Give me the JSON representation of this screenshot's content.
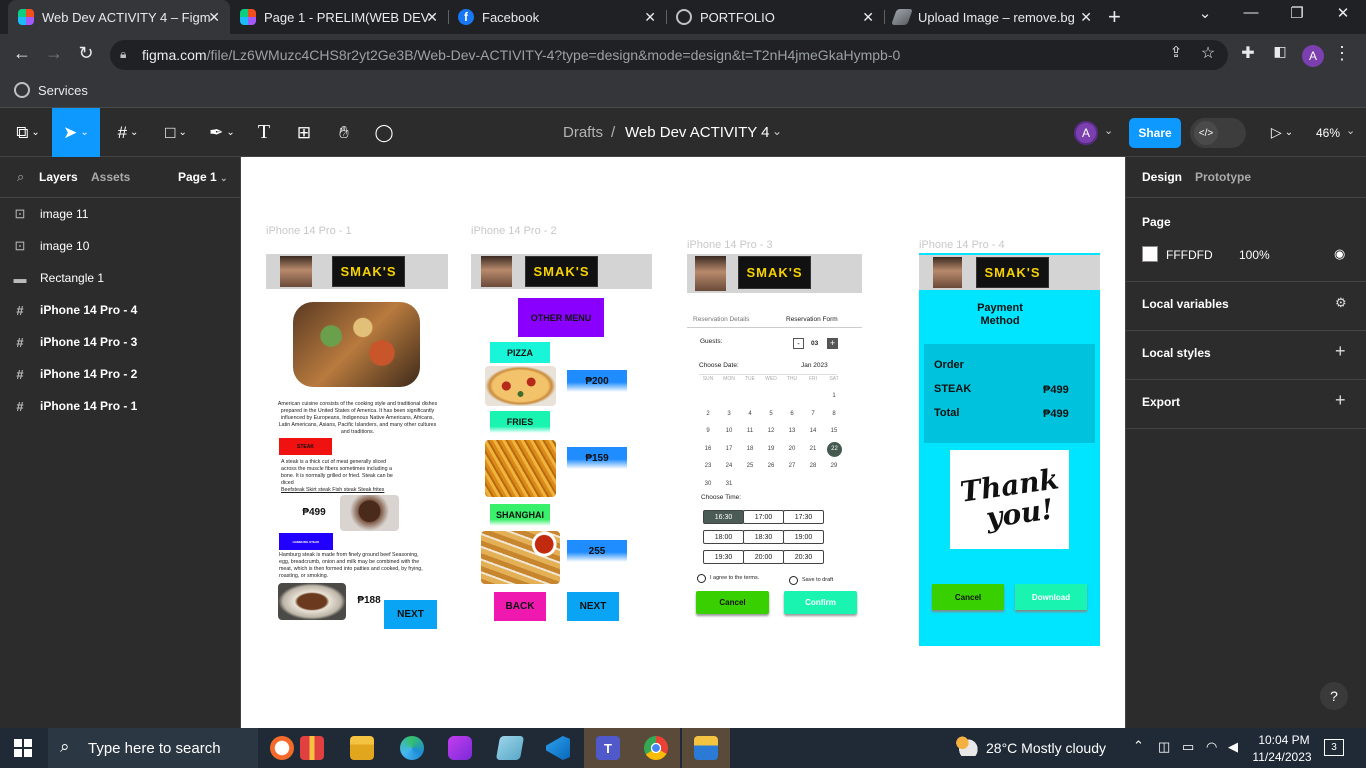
{
  "browser": {
    "tabs": [
      {
        "label": "Web Dev ACTIVITY 4 – Figm",
        "active": true
      },
      {
        "label": "Page 1 - PRELIM(WEB DEV"
      },
      {
        "label": "Facebook"
      },
      {
        "label": "PORTFOLIO"
      },
      {
        "label": "Upload Image – remove.bg"
      }
    ],
    "url_domain": "figma.com",
    "url_path": "/file/Lz6WMuzc4CHS8r2yt2Ge3B/Web-Dev-ACTIVITY-4?type=design&mode=design&t=T2nH4jmeGkaHympb-0",
    "bookmark": "Services",
    "profile_initial": "A"
  },
  "toolbar": {
    "breadcrumb_root": "Drafts",
    "breadcrumb_sep": "/",
    "file_name": "Web Dev ACTIVITY 4",
    "avatar": "A",
    "share_label": "Share",
    "zoom": "46%"
  },
  "leftpanel": {
    "tab_layers": "Layers",
    "tab_assets": "Assets",
    "page": "Page 1",
    "layers": [
      {
        "icon": "image-icon",
        "label": "image 11"
      },
      {
        "icon": "image-icon",
        "label": "image 10"
      },
      {
        "icon": "rectangle-icon",
        "label": "Rectangle 1"
      },
      {
        "icon": "frame-icon",
        "label": "iPhone 14 Pro - 4"
      },
      {
        "icon": "frame-icon",
        "label": "iPhone 14 Pro - 3"
      },
      {
        "icon": "frame-icon",
        "label": "iPhone 14 Pro - 2"
      },
      {
        "icon": "frame-icon",
        "label": "iPhone 14 Pro - 1"
      }
    ]
  },
  "rightpanel": {
    "tab_design": "Design",
    "tab_prototype": "Prototype",
    "page_heading": "Page",
    "page_color": "FFFDFD",
    "page_opacity": "100%",
    "local_variables": "Local variables",
    "local_styles": "Local styles",
    "export": "Export",
    "help": "?"
  },
  "canvas": {
    "frame1": {
      "label": "iPhone 14 Pro - 1",
      "logo": "SMAK'S",
      "desc": "American cuisine consists of the cooking style and traditional dishes prepared in the United States of America. It has been significantly influenced by Europeans, Indigenous Native Americans, Africans, Latin Americans, Asians, Pacific Islanders, and many other cultures and traditions.",
      "steak_tag": "STEAK",
      "steak_desc": "A steak is a thick cut of meat generally sliced across the muscle fibers sometimes including a bone. It is normally grilled or fried. Steak can be diced",
      "steak_types": "Beefsteak  Skirt steak   Fish steak   Steak frites",
      "steak_price": "₱499",
      "hamburg_tag": "HAMBURG STEAK",
      "hamburg_desc": "Hamburg steak is made from finely ground beef Seasoning, egg, breadcrumb, onion and milk may be combined with the meat, which is then formed into patties and cooked, by frying, roasting, or smoking.",
      "hamburg_price": "₱188",
      "next": "NEXT"
    },
    "frame2": {
      "label": "iPhone 14 Pro - 2",
      "other_menu": "OTHER MENU",
      "pizza": "PIZZA",
      "pizza_price": "₱200",
      "fries": "FRIES",
      "fries_price": "₱159",
      "shanghai": "SHANGHAI",
      "shanghai_price": "255",
      "back": "BACK",
      "next": "NEXT"
    },
    "frame3": {
      "label": "iPhone 14 Pro - 3",
      "tab1": "Reservation Details",
      "tab2": "Reservation Form",
      "guests_label": "Guests:",
      "guests_value": "03",
      "date_label": "Choose Date:",
      "month": "Jan 2023",
      "weekdays": [
        "SUN",
        "MON",
        "TUE",
        "WED",
        "THU",
        "FRI",
        "SAT"
      ],
      "days": [
        "",
        "",
        "",
        "",
        "",
        "",
        "1",
        "2",
        "3",
        "4",
        "5",
        "6",
        "7",
        "8",
        "9",
        "10",
        "11",
        "12",
        "13",
        "14",
        "15",
        "16",
        "17",
        "18",
        "19",
        "20",
        "21",
        "22",
        "23",
        "24",
        "25",
        "26",
        "27",
        "28",
        "29",
        "30",
        "31"
      ],
      "selected_day": "22",
      "time_label": "Choose Time:",
      "times": [
        "16:30",
        "17:00",
        "17:30",
        "18:00",
        "18:30",
        "19:00",
        "19:30",
        "20:00",
        "20:30"
      ],
      "selected_time": "16:30",
      "agree": "I agree to the terms.",
      "save_draft": "Save to draft",
      "cancel": "Cancel",
      "confirm": "Confirm"
    },
    "frame4": {
      "label": "iPhone 14 Pro - 4",
      "title_line1": "Payment",
      "title_line2": "Method",
      "order": "Order",
      "item": "STEAK",
      "item_price": "₱499",
      "total": "Total",
      "total_price": "₱499",
      "thanks_line1": "Thank",
      "thanks_line2": "you!",
      "cancel": "Cancel",
      "download": "Download"
    }
  },
  "taskbar": {
    "search_placeholder": "Type here to search",
    "weather": "28°C  Mostly cloudy",
    "time": "10:04 PM",
    "date": "11/24/2023",
    "notif": "3"
  },
  "colors": {
    "figma_blue": "#0d99ff",
    "cyan": "#00e5ff",
    "green": "#39d000",
    "mint": "#19f5b0",
    "purple": "#8a00ff",
    "magenta": "#f019b0",
    "red": "#f01111"
  }
}
